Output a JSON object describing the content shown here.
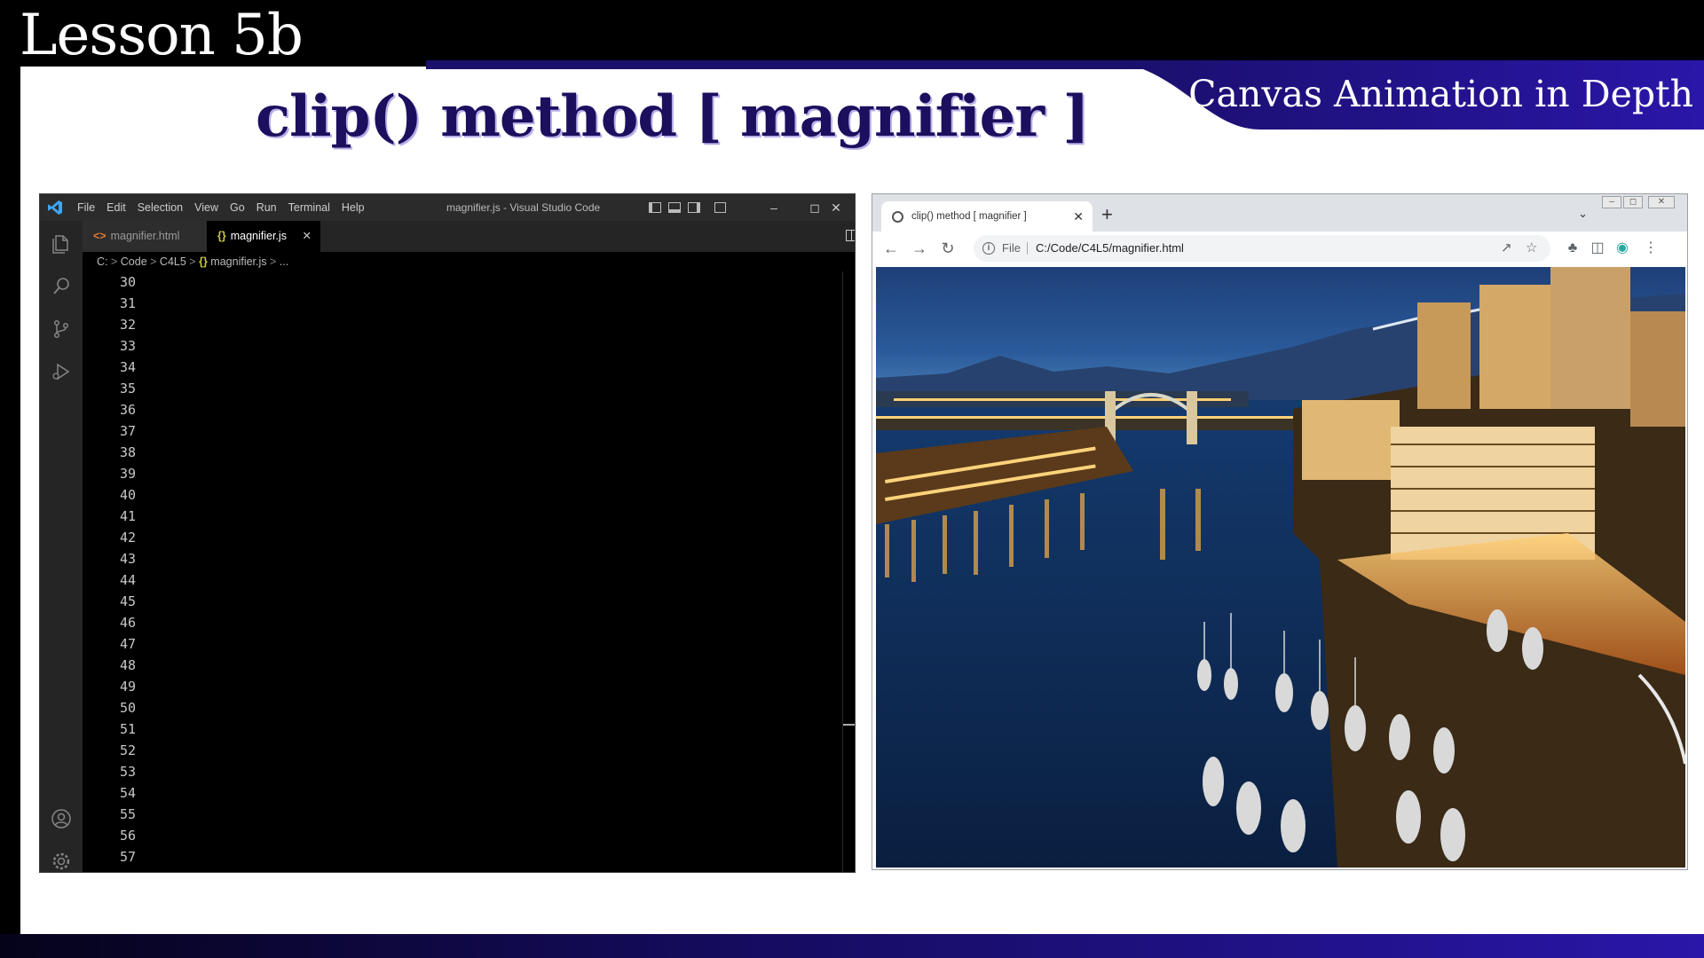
{
  "slide": {
    "lesson_title": "Lesson 5b",
    "course_title": "Canvas Animation in Depth",
    "heading": "clip() method [ magnifier ]"
  },
  "vscode": {
    "menu": [
      "File",
      "Edit",
      "Selection",
      "View",
      "Go",
      "Run",
      "Terminal",
      "Help"
    ],
    "window_title": "magnifier.js - Visual Studio Code",
    "tabs": [
      {
        "label": "magnifier.html",
        "icon": "html-file-icon",
        "active": false
      },
      {
        "label": "magnifier.js",
        "icon": "js-file-icon",
        "active": true
      }
    ],
    "breadcrumb": [
      "C:",
      "Code",
      "C4L5",
      "magnifier.js",
      "..."
    ],
    "line_numbers": [
      "30",
      "31",
      "32",
      "33",
      "34",
      "35",
      "36",
      "37",
      "38",
      "39",
      "40",
      "41",
      "42",
      "43",
      "44",
      "45",
      "46",
      "47",
      "48",
      "49",
      "50",
      "51",
      "52",
      "53",
      "54",
      "55",
      "56",
      "57"
    ],
    "accent": "#007acc"
  },
  "chrome": {
    "tab_title": "clip() method [ magnifier ]",
    "omnibox_scheme": "File",
    "url": "C:/Code/C4L5/magnifier.html"
  },
  "colors": {
    "slide_navy": "#1b0f5e",
    "band": "#1a0f6b"
  }
}
